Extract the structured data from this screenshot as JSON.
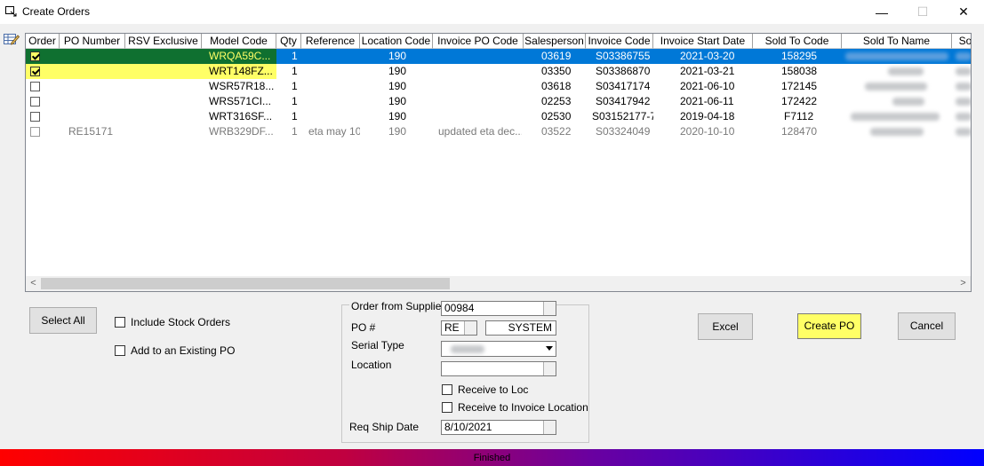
{
  "window": {
    "title": "Create Orders",
    "minimize": "—",
    "maximize": "☐",
    "close": "✕"
  },
  "grid": {
    "columns": [
      "Order",
      "PO Number",
      "RSV Exclusive",
      "Model Code",
      "Qty",
      "Reference",
      "Location Code",
      "Invoice PO Code",
      "Salesperson",
      "Invoice Code",
      "Invoice Start Date",
      "Sold To Code",
      "Sold To Name",
      "So"
    ],
    "rows": [
      {
        "checked": true,
        "po": "",
        "model": "WRQA59C...",
        "qty": "1",
        "ref": "",
        "loc": "190",
        "invpo": "",
        "sales": "03619",
        "inv": "S03386755",
        "start": "2021-03-20",
        "sold": "158295"
      },
      {
        "checked": true,
        "po": "",
        "model": "WRT148FZ...",
        "qty": "1",
        "ref": "",
        "loc": "190",
        "invpo": "",
        "sales": "03350",
        "inv": "S03386870",
        "start": "2021-03-21",
        "sold": "158038"
      },
      {
        "checked": false,
        "po": "",
        "model": "WSR57R18...",
        "qty": "1",
        "ref": "",
        "loc": "190",
        "invpo": "",
        "sales": "03618",
        "inv": "S03417174",
        "start": "2021-06-10",
        "sold": "172145"
      },
      {
        "checked": false,
        "po": "",
        "model": "WRS571CI...",
        "qty": "1",
        "ref": "",
        "loc": "190",
        "invpo": "",
        "sales": "02253",
        "inv": "S03417942",
        "start": "2021-06-11",
        "sold": "172422"
      },
      {
        "checked": false,
        "po": "",
        "model": "WRT316SF...",
        "qty": "1",
        "ref": "",
        "loc": "190",
        "invpo": "",
        "sales": "02530",
        "inv": "S03152177-7",
        "start": "2019-04-18",
        "sold": "F7112"
      },
      {
        "checked": false,
        "po": "RE15171",
        "model": "WRB329DF...",
        "qty": "1",
        "ref": "eta may 10",
        "loc": "190",
        "invpo": "updated eta dec...",
        "sales": "03522",
        "inv": "S03324049",
        "start": "2020-10-10",
        "sold": "128470"
      }
    ],
    "scroll_left": "<",
    "scroll_right": ">"
  },
  "buttons": {
    "select_all": "Select All",
    "excel": "Excel",
    "create_po": "Create PO",
    "cancel": "Cancel"
  },
  "options": {
    "include_stock": "Include Stock Orders",
    "add_existing": "Add to an Existing PO"
  },
  "supplier_group": {
    "title": "Order from Supplier",
    "supplier_value": "00984",
    "po_label": "PO #",
    "po_prefix": "RE",
    "po_user": "SYSTEM",
    "serial_label": "Serial Type",
    "location_label": "Location",
    "receive_loc": "Receive to Loc",
    "receive_invoice": "Receive to Invoice Location",
    "req_ship_label": "Req Ship Date",
    "req_ship_value": "8/10/2021"
  },
  "status": {
    "text": "Finished"
  }
}
